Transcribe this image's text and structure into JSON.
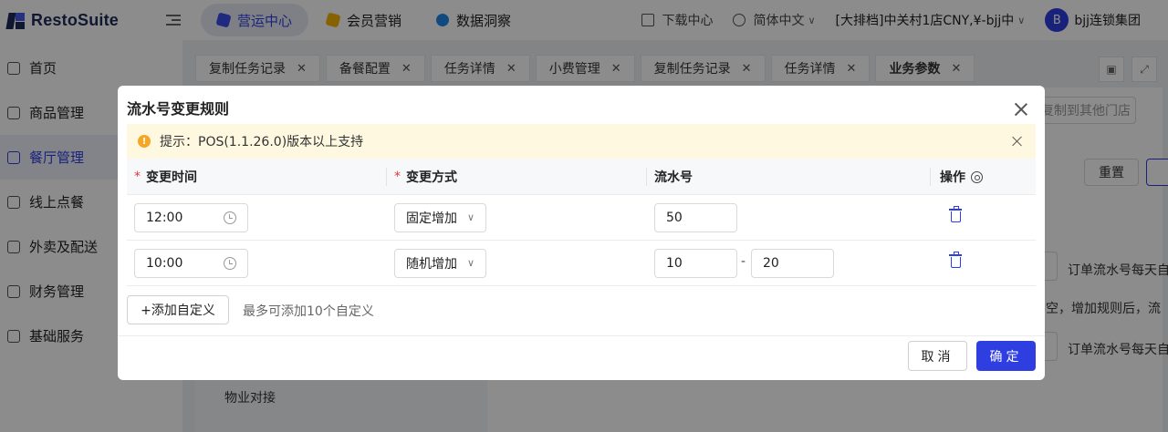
{
  "app": {
    "logo_text": "RestoSuite",
    "top_tabs": [
      {
        "label": "营运中心",
        "active": true,
        "color": "#3a4be8"
      },
      {
        "label": "会员营销",
        "active": false,
        "color": "#f5b400"
      },
      {
        "label": "数据洞察",
        "active": false,
        "color": "#1e88e5"
      }
    ],
    "download_label": "下载中心",
    "language_label": "简体中文",
    "store_label": "[大排档]中关村1店CNY,¥-bjj中",
    "avatar_letter": "B",
    "org_label": "bjj连锁集团"
  },
  "sidebar": {
    "items": [
      {
        "label": "首页",
        "icon": "home-icon",
        "active": false
      },
      {
        "label": "商品管理",
        "icon": "box-icon",
        "active": false
      },
      {
        "label": "餐厅管理",
        "icon": "store-icon",
        "active": true
      },
      {
        "label": "线上点餐",
        "icon": "hand-icon",
        "active": false
      },
      {
        "label": "外卖及配送",
        "icon": "bag-icon",
        "active": false
      },
      {
        "label": "财务管理",
        "icon": "folder-icon",
        "active": false
      },
      {
        "label": "基础服务",
        "icon": "grid-icon",
        "active": false
      }
    ]
  },
  "content": {
    "tabs": [
      {
        "label": "复制任务记录",
        "active": false
      },
      {
        "label": "备餐配置",
        "active": false
      },
      {
        "label": "任务详情",
        "active": false
      },
      {
        "label": "小费管理",
        "active": false
      },
      {
        "label": "复制任务记录",
        "active": false
      },
      {
        "label": "任务详情",
        "active": false
      },
      {
        "label": "业务参数",
        "active": true
      }
    ],
    "copy_to_stores": "复制到其他门店",
    "reset_label": "重置",
    "right_text_1": "订单流水号每天自",
    "right_text_2": "空，增加规则后，流",
    "right_text_3": "订单流水号每天自",
    "left_item": "物业对接"
  },
  "modal": {
    "title": "流水号变更规则",
    "alert_text": "提示：POS(1.1.26.0)版本以上支持",
    "columns": {
      "time": "变更时间",
      "method": "变更方式",
      "serial": "流水号",
      "action": "操作"
    },
    "rows": [
      {
        "time": "12:00",
        "method": "固定增加",
        "serial_from": "50",
        "serial_to": ""
      },
      {
        "time": "10:00",
        "method": "随机增加",
        "serial_from": "10",
        "serial_to": "20"
      }
    ],
    "range_separator": "-",
    "add_label": "+添加自定义",
    "add_hint": "最多可添加10个自定义",
    "cancel_label": "取消",
    "confirm_label": "确定"
  },
  "colors": {
    "primary": "#2f3ee0",
    "alert_bg": "#fff8e0",
    "warning": "#f5a623",
    "required": "#e53935"
  }
}
